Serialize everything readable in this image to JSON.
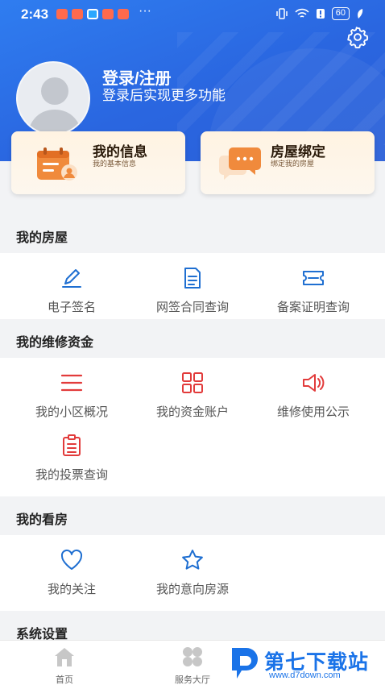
{
  "status_bar": {
    "time": "2:43",
    "more": "···",
    "battery": "60"
  },
  "profile": {
    "title": "登录/注册",
    "subtitle": "登录后实现更多功能"
  },
  "cards": {
    "info": {
      "title": "我的信息",
      "subtitle": "我的基本信息"
    },
    "house": {
      "title": "房屋绑定",
      "subtitle": "绑定我的房屋"
    }
  },
  "sections": {
    "my_house": {
      "title": "我的房屋",
      "items": [
        {
          "label": "电子签名",
          "icon": "pen-icon"
        },
        {
          "label": "网签合同查询",
          "icon": "document-icon"
        },
        {
          "label": "备案证明查询",
          "icon": "ticket-icon"
        }
      ]
    },
    "maintenance": {
      "title": "我的维修资金",
      "items": [
        {
          "label": "我的小区概况",
          "icon": "list-icon"
        },
        {
          "label": "我的资金账户",
          "icon": "grid-icon"
        },
        {
          "label": "维修使用公示",
          "icon": "speaker-icon"
        },
        {
          "label": "我的投票查询",
          "icon": "vote-list-icon"
        }
      ]
    },
    "viewing": {
      "title": "我的看房",
      "items": [
        {
          "label": "我的关注",
          "icon": "heart-icon"
        },
        {
          "label": "我的意向房源",
          "icon": "star-icon"
        }
      ]
    },
    "settings": {
      "title": "系统设置"
    }
  },
  "bottom_nav": {
    "home": "首页",
    "service": "服务大厅"
  },
  "watermark": {
    "text": "第七下载站",
    "url": "www.d7down.com"
  },
  "colors": {
    "header_blue": "#2a66e0",
    "icon_blue": "#1f6fd1",
    "icon_red": "#e23b3b",
    "card_orange": "#f08a3c"
  }
}
